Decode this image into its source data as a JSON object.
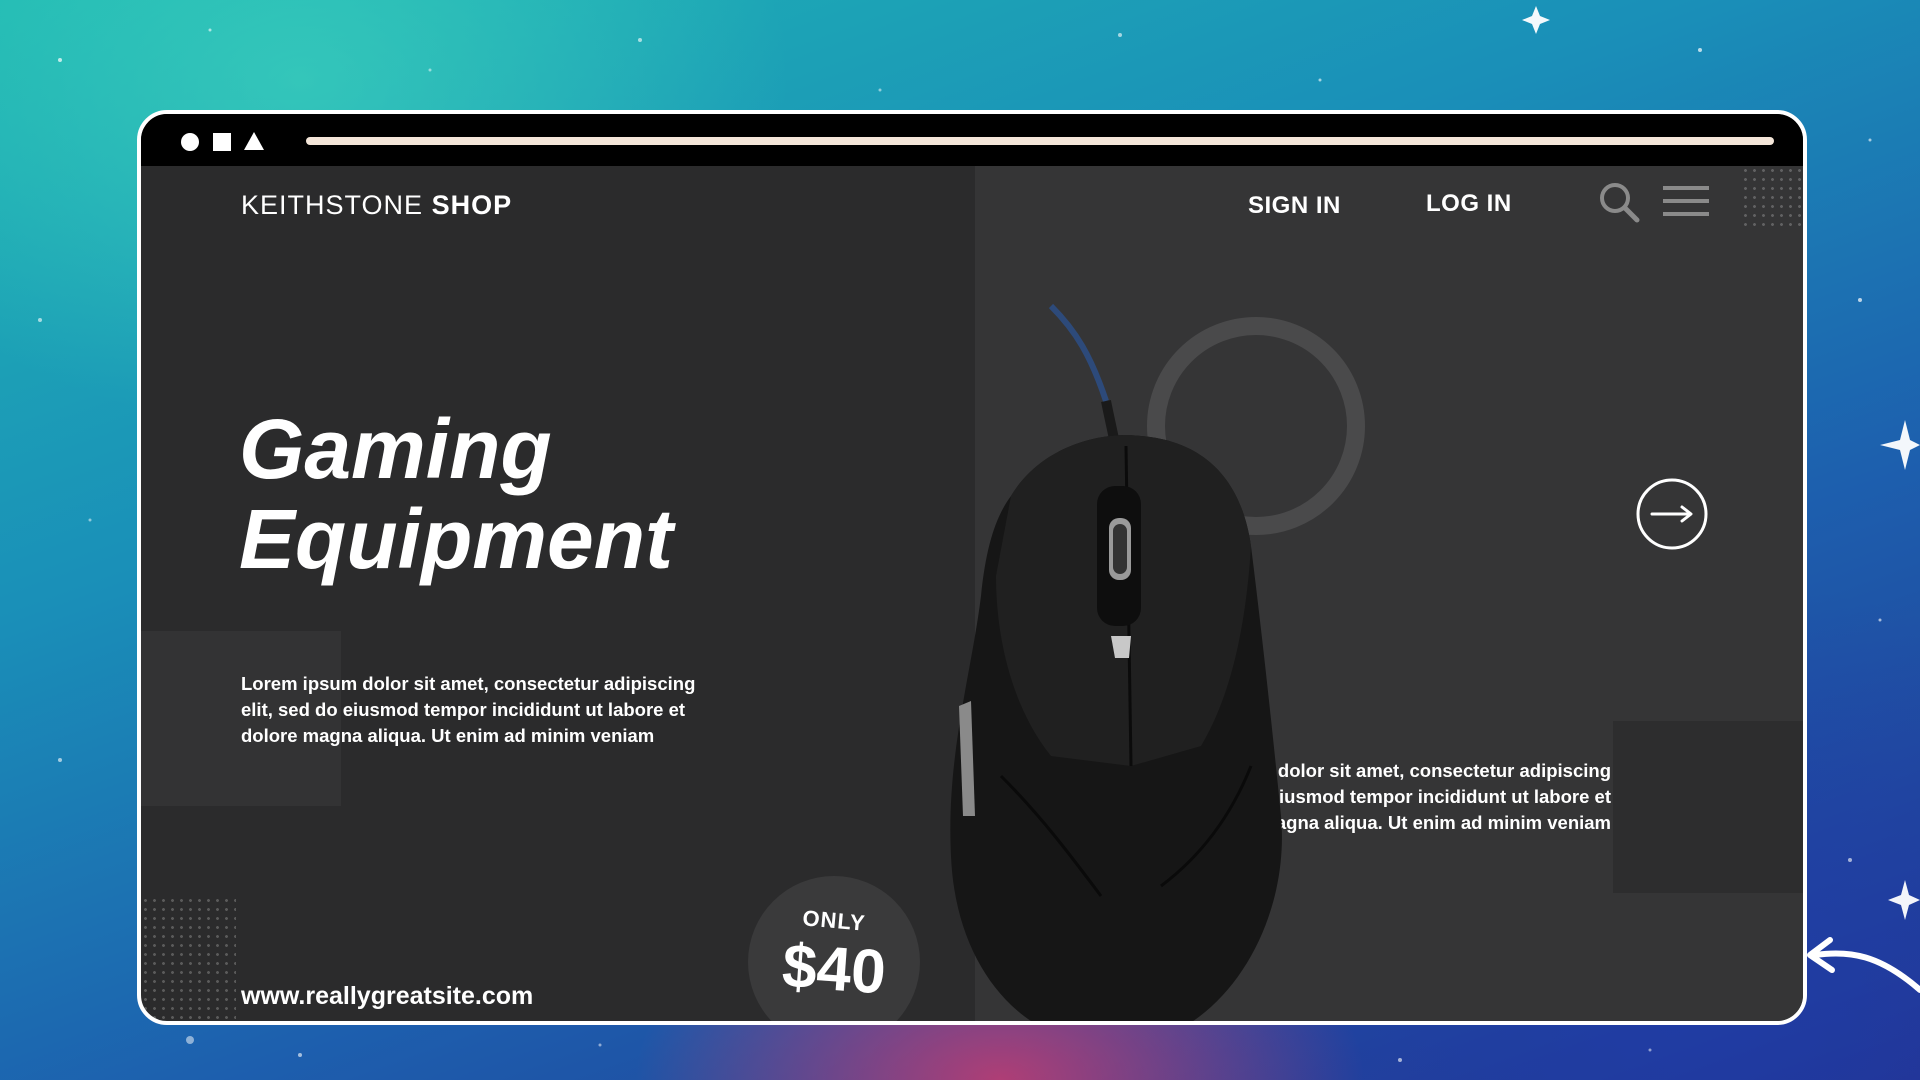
{
  "brand": {
    "name": "KEITHSTONE",
    "name_bold": "SHOP"
  },
  "nav": {
    "sign_in": "SIGN IN",
    "log_in": "LOG IN"
  },
  "icons": {
    "window_controls": [
      "circle-icon",
      "square-icon",
      "triangle-icon"
    ],
    "search": "search-icon",
    "menu": "hamburger-menu-icon",
    "next": "arrow-right-circle-icon"
  },
  "hero": {
    "title_line1": "Gaming",
    "title_line2": "Equipment",
    "description_left": "Lorem ipsum dolor sit amet, consectetur adipiscing elit, sed do eiusmod tempor incididunt ut labore et dolore magna aliqua. Ut enim ad minim veniam",
    "description_right": "Lorem ipsum dolor sit amet, consectetur adipiscing elit, sed do eiusmod tempor incididunt ut labore et dolore magna aliqua. Ut enim ad minim veniam"
  },
  "price": {
    "label": "ONLY",
    "value": "$40"
  },
  "footer": {
    "url": "www.reallygreatsite.com"
  },
  "colors": {
    "page_background": "#2b2b2c",
    "panel_background": "#353536",
    "titlebar": "#000000",
    "url_bar": "#f4e6d9",
    "text": "#ffffff"
  }
}
